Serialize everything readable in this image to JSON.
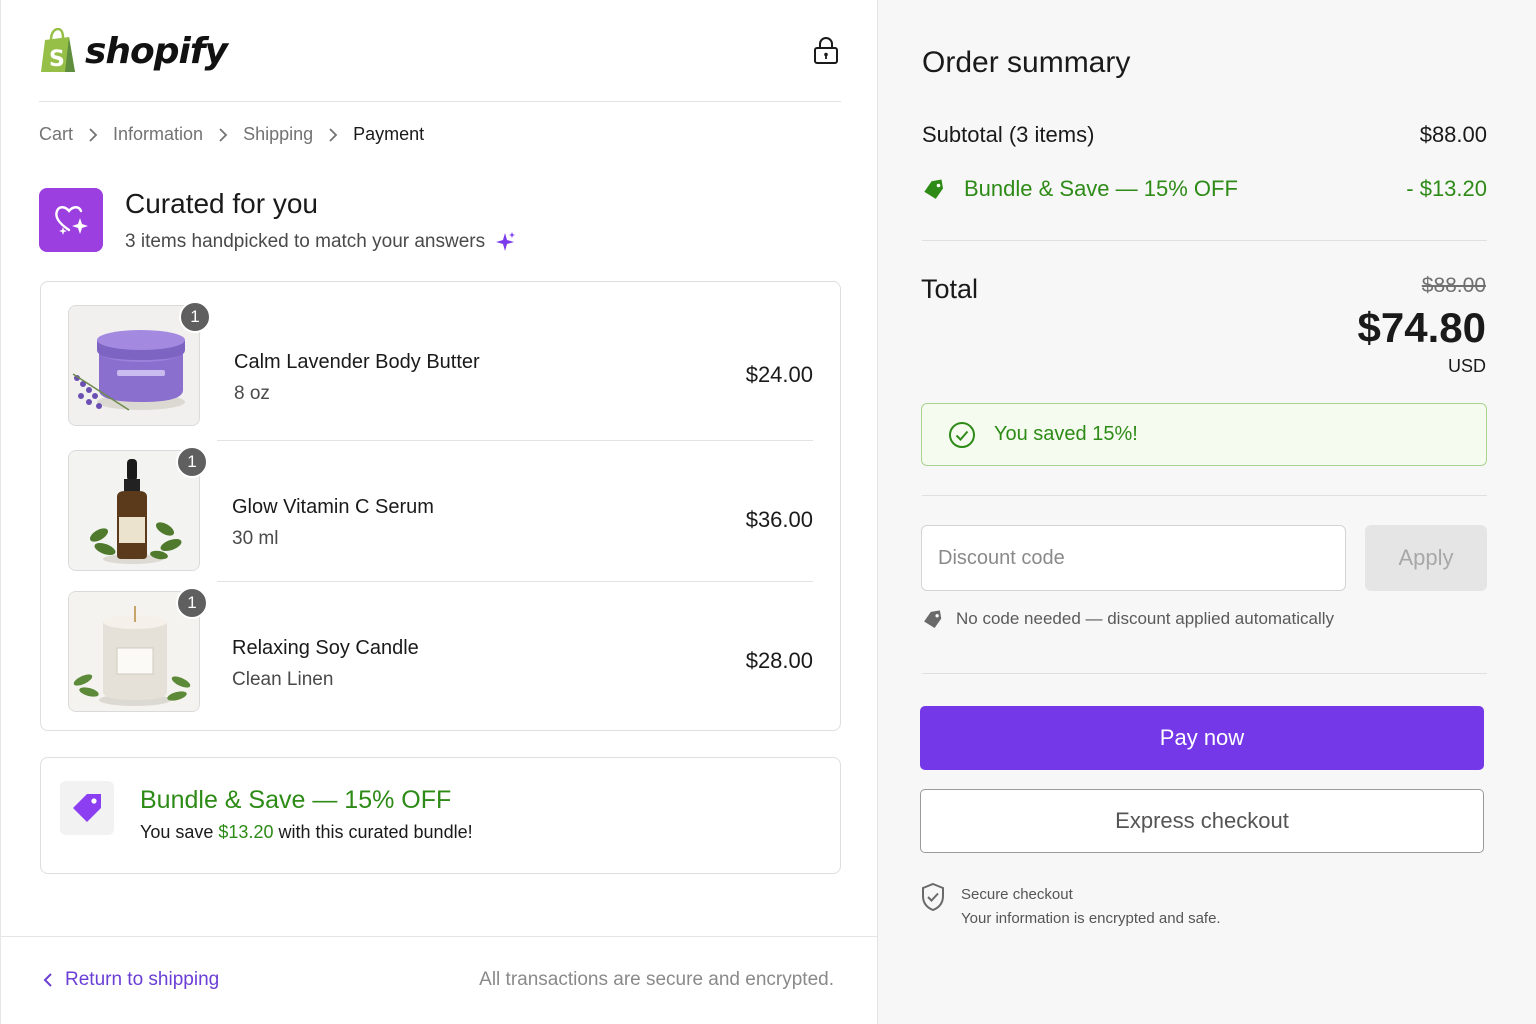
{
  "brand": {
    "name": "shopify",
    "logo_color": "#95bf47"
  },
  "breadcrumb": {
    "items": [
      {
        "label": "Cart"
      },
      {
        "label": "Information"
      },
      {
        "label": "Shipping"
      },
      {
        "label": "Payment",
        "current": true
      }
    ]
  },
  "curated": {
    "title": "Curated for you",
    "subtitle": "3 items handpicked to match your answers"
  },
  "cart": {
    "items": [
      {
        "name": "Calm Lavender Body Butter",
        "variant": "8 oz",
        "price": "$24.00",
        "qty": "1",
        "image": "lavender-jar"
      },
      {
        "name": "Glow Vitamin C Serum",
        "variant": "30 ml",
        "price": "$36.00",
        "qty": "1",
        "image": "serum-bottle"
      },
      {
        "name": "Relaxing Soy Candle",
        "variant": "Clean Linen",
        "price": "$28.00",
        "qty": "1",
        "image": "candle-jar"
      }
    ]
  },
  "bundle": {
    "title": "Bundle & Save — 15% OFF",
    "sub_prefix": "You save ",
    "amount": "$13.20",
    "sub_suffix": " with this curated bundle!"
  },
  "footer": {
    "back_label": "Return to shipping",
    "secure_text": "All transactions are secure and encrypted."
  },
  "summary": {
    "title": "Order summary",
    "subtotal_label": "Subtotal (3 items)",
    "subtotal_value": "$88.00",
    "discount_label": "Bundle & Save — 15% OFF",
    "discount_value": "- $13.20",
    "total_label": "Total",
    "total_original": "$88.00",
    "total_value": "$74.80",
    "currency": "USD",
    "saved_text": "You saved 15%!",
    "discount_placeholder": "Discount code",
    "apply_label": "Apply",
    "auto_note": "No code needed — discount applied automatically",
    "pay_label": "Pay now",
    "express_label": "Express checkout",
    "secure_title": "Secure checkout",
    "secure_sub": "Your information is encrypted and safe."
  },
  "colors": {
    "accent": "#7438e8",
    "success": "#2e8b17",
    "curated_badge": "#9b3fe0"
  }
}
